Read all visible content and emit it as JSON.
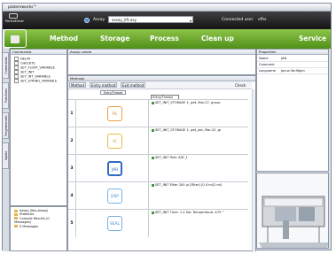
{
  "window": {
    "title": "platereworks™"
  },
  "toolbar": {
    "assay_label": "Assay",
    "assay_value": "assay_lift.asy",
    "connected_label": "Connected user",
    "connected_value": "vfhs",
    "logo_text": "PerkinElmer"
  },
  "ribbon": {
    "steps": [
      "Method",
      "Storage",
      "Process",
      "Clean up",
      "Service"
    ]
  },
  "sidebar": {
    "tabs": [
      "Commands",
      "Functions",
      "Programmatic",
      "Inputs"
    ]
  },
  "commands": {
    "title": "Commands",
    "items": [
      "DELAY",
      "CHECKTS",
      "SET_FLOAT_VARIABLE",
      "SET_INIT",
      "SET_INT_VARIABLE",
      "SET_STRING_VARIABLE"
    ]
  },
  "assay": {
    "title": "Assay: photo"
  },
  "methods": {
    "title": "Methods",
    "buttons": [
      "Method",
      "Entry method",
      "Exit method"
    ],
    "check_label": "Check",
    "dropdown_label": "Entry/Thread",
    "thread_label": "Entry/Thread",
    "rows": [
      {
        "num": "1",
        "icon": "PL",
        "text": "SET_INIT_STORAGE 1, get, Mar-27, group"
      },
      {
        "num": "2",
        "icon": "IC",
        "text": "SET_INIT_STORAGE 1, get_out, Mar-22, gr"
      },
      {
        "num": "3",
        "icon": "JAR",
        "text": "SET_INIT Test: SAT_1"
      },
      {
        "num": "4",
        "icon": "DSP",
        "text": "SET_INIT Filter 200 µl [Filter] (0.4 ml/2 ml)"
      },
      {
        "num": "5",
        "icon": "SEAL",
        "text": "SET_INIT Time: 1.2 Sec Temperature: 475 °"
      }
    ]
  },
  "properties": {
    "title": "Properties",
    "rows": [
      {
        "k": "Name",
        "v": "JAN"
      },
      {
        "k": "Comment",
        "v": ""
      },
      {
        "k": "Longname",
        "v": "Janus Verifigen"
      }
    ]
  },
  "results": {
    "items": [
      "Assay (Ibis-Assay)",
      "Statistics",
      "Compile Results (0 Messages)",
      "0 Messages"
    ]
  },
  "colors": {
    "ribbon_green": "#5a9b21",
    "top_bar": "#1b1b1b"
  }
}
